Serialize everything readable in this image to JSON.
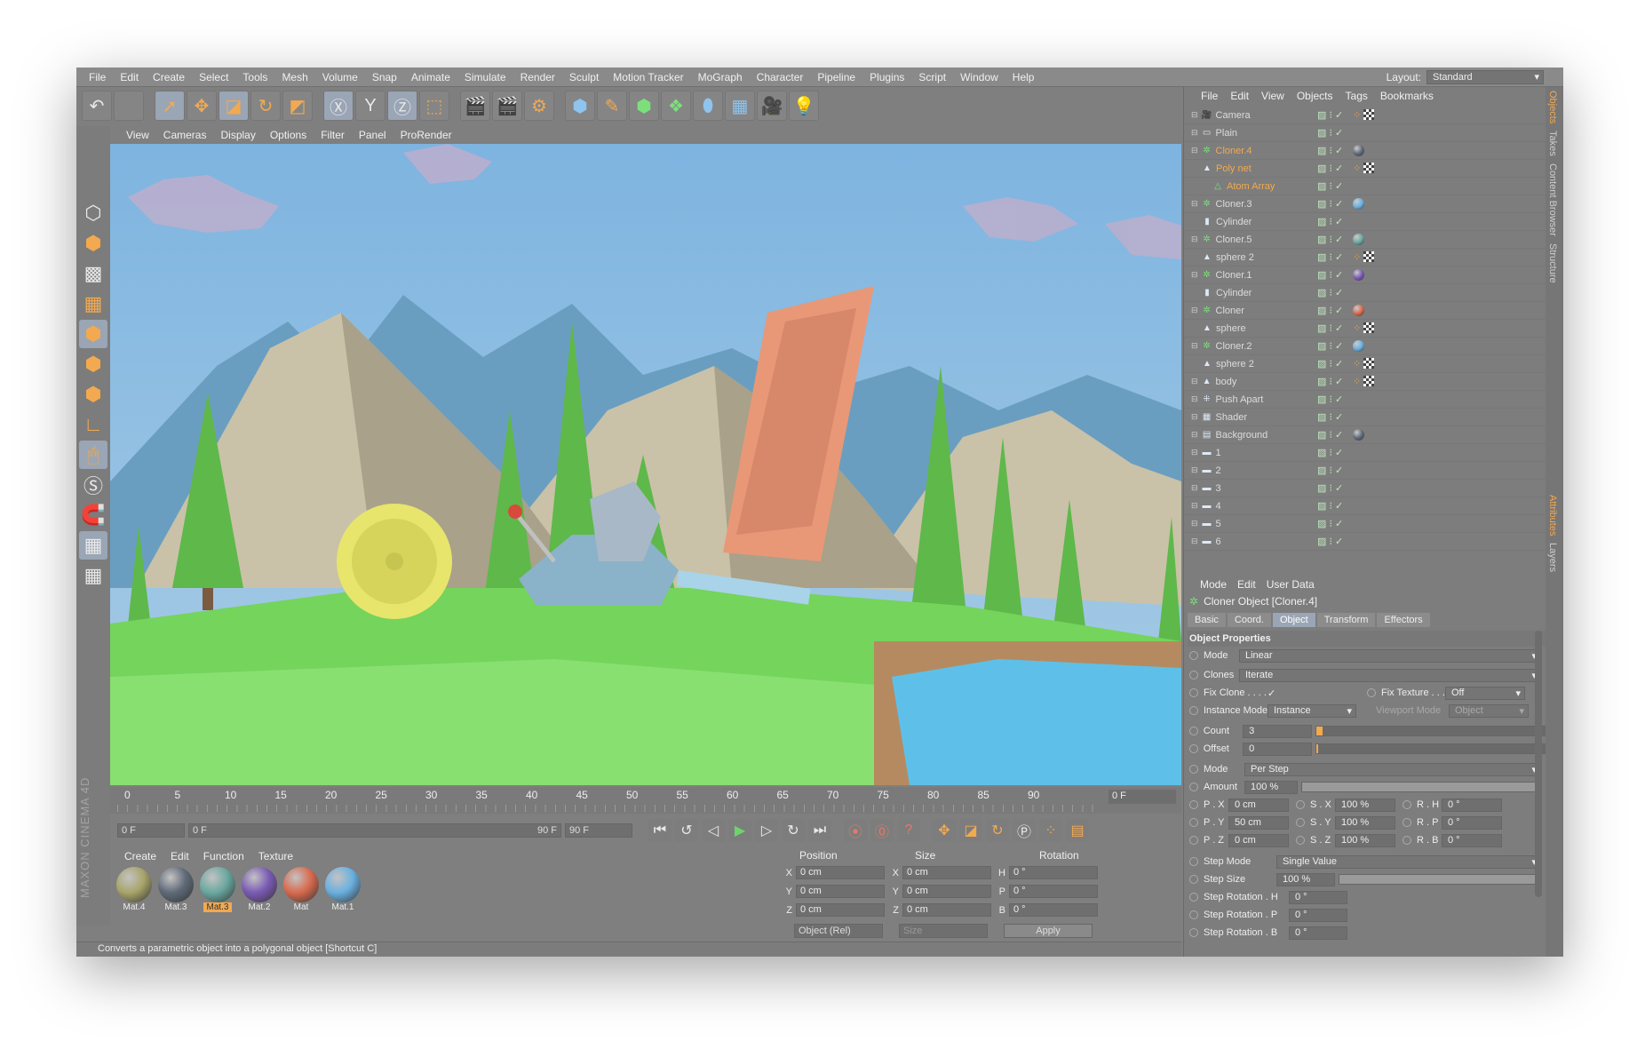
{
  "menu": [
    "File",
    "Edit",
    "Create",
    "Select",
    "Tools",
    "Mesh",
    "Volume",
    "Snap",
    "Animate",
    "Simulate",
    "Render",
    "Sculpt",
    "Motion Tracker",
    "MoGraph",
    "Character",
    "Pipeline",
    "Plugins",
    "Script",
    "Window",
    "Help"
  ],
  "layout": {
    "label": "Layout:",
    "value": "Standard"
  },
  "viewport_menu": [
    "View",
    "Cameras",
    "Display",
    "Options",
    "Filter",
    "Panel",
    "ProRender"
  ],
  "timeline": {
    "ticks": [
      "0",
      "5",
      "10",
      "15",
      "20",
      "25",
      "30",
      "35",
      "40",
      "45",
      "50",
      "55",
      "60",
      "65",
      "70",
      "75",
      "80",
      "85",
      "90"
    ],
    "frame": "0 F"
  },
  "transport": {
    "start": "0 F",
    "range_start": "0 F",
    "range_end": "90 F",
    "end": "90 F"
  },
  "material_menu": [
    "Create",
    "Edit",
    "Function",
    "Texture"
  ],
  "materials": [
    {
      "name": "Mat.4",
      "color": "#a8a46a"
    },
    {
      "name": "Mat.3",
      "color": "#5f6a78"
    },
    {
      "name": "Mat.3",
      "color": "#6aa8a0",
      "selected": true
    },
    {
      "name": "Mat.2",
      "color": "#7a5ab4"
    },
    {
      "name": "Mat",
      "color": "#d86a4e"
    },
    {
      "name": "Mat.1",
      "color": "#6ab0e0"
    }
  ],
  "brand": "MAXON CINEMA 4D",
  "coords": {
    "headers": [
      "Position",
      "Size",
      "Rotation"
    ],
    "rows": [
      {
        "pa": "X",
        "pv": "0 cm",
        "sa": "X",
        "sv": "0 cm",
        "ra": "H",
        "rv": "0 °"
      },
      {
        "pa": "Y",
        "pv": "0 cm",
        "sa": "Y",
        "sv": "0 cm",
        "ra": "P",
        "rv": "0 °"
      },
      {
        "pa": "Z",
        "pv": "0 cm",
        "sa": "Z",
        "sv": "0 cm",
        "ra": "B",
        "rv": "0 °"
      }
    ],
    "mode": "Object (Rel)",
    "size_mode": "Size",
    "apply": "Apply"
  },
  "status": "Converts a parametric object into a polygonal object [Shortcut C]",
  "objects_menu": [
    "File",
    "Edit",
    "View",
    "Objects",
    "Tags",
    "Bookmarks"
  ],
  "objects": [
    {
      "name": "Camera",
      "icon": "camera-icon",
      "indent": 0,
      "tag": "chk"
    },
    {
      "name": "Plain",
      "icon": "plain-effector-icon",
      "indent": 0
    },
    {
      "name": "Cloner.4",
      "icon": "cloner-icon",
      "indent": 0,
      "hl": true,
      "tag": "ball",
      "color": "#5f6a78"
    },
    {
      "name": "Poly net",
      "icon": "polygon-icon",
      "indent": 1,
      "hl": true,
      "tag": "chk"
    },
    {
      "name": "Atom Array",
      "icon": "atom-array-icon",
      "indent": 2,
      "hl": true
    },
    {
      "name": "Cloner.3",
      "icon": "cloner-icon",
      "indent": 0,
      "tag": "ball",
      "color": "#6ab0e0"
    },
    {
      "name": "Cylinder",
      "icon": "cylinder-icon",
      "indent": 1
    },
    {
      "name": "Cloner.5",
      "icon": "cloner-icon",
      "indent": 0,
      "tag": "ball",
      "color": "#6aa8a0"
    },
    {
      "name": "sphere 2",
      "icon": "polygon-icon",
      "indent": 1,
      "tag": "chk"
    },
    {
      "name": "Cloner.1",
      "icon": "cloner-icon",
      "indent": 0,
      "tag": "ball",
      "color": "#7a5ab4"
    },
    {
      "name": "Cylinder",
      "icon": "cylinder-icon",
      "indent": 1
    },
    {
      "name": "Cloner",
      "icon": "cloner-icon",
      "indent": 0,
      "tag": "ball",
      "color": "#d86a4e"
    },
    {
      "name": "sphere",
      "icon": "polygon-icon",
      "indent": 1,
      "tag": "chk"
    },
    {
      "name": "Cloner.2",
      "icon": "cloner-icon",
      "indent": 0,
      "tag": "ball",
      "color": "#6ab0e0"
    },
    {
      "name": "sphere 2",
      "icon": "polygon-icon",
      "indent": 1,
      "tag": "chk"
    },
    {
      "name": "body",
      "icon": "polygon-icon",
      "indent": 0,
      "tag": "chk"
    },
    {
      "name": "Push Apart",
      "icon": "push-apart-icon",
      "indent": 0
    },
    {
      "name": "Shader",
      "icon": "shader-icon",
      "indent": 0
    },
    {
      "name": "Background",
      "icon": "background-icon",
      "indent": 0,
      "tag": "ball",
      "color": "#5f6a78"
    },
    {
      "name": "1",
      "icon": "folder-icon",
      "indent": 0
    },
    {
      "name": "2",
      "icon": "folder-icon",
      "indent": 0
    },
    {
      "name": "3",
      "icon": "folder-icon",
      "indent": 0
    },
    {
      "name": "4",
      "icon": "folder-icon",
      "indent": 0
    },
    {
      "name": "5",
      "icon": "folder-icon",
      "indent": 0
    },
    {
      "name": "6",
      "icon": "folder-icon",
      "indent": 0
    }
  ],
  "right_tabs": [
    "Objects",
    "Takes",
    "Content Browser",
    "Structure"
  ],
  "attr_tabs_side": [
    "Attributes",
    "Layers"
  ],
  "attr_menu": [
    "Mode",
    "Edit",
    "User Data"
  ],
  "attr_title": "Cloner Object [Cloner.4]",
  "attr_tabs": [
    "Basic",
    "Coord.",
    "Object",
    "Transform",
    "Effectors"
  ],
  "attr": {
    "section": "Object Properties",
    "mode_label": "Mode",
    "mode": "Linear",
    "clones_label": "Clones",
    "clones": "Iterate",
    "fixclone_label": "Fix Clone . . . .",
    "fixclone": "✓",
    "fixtexture_label": "Fix Texture . . .",
    "fixtexture": "Off",
    "instance_label": "Instance Mode",
    "instance": "Instance",
    "viewport_label": "Viewport Mode",
    "viewport": "Object",
    "count_label": "Count",
    "count": "3",
    "offset_label": "Offset",
    "offset": "0",
    "mode2_label": "Mode",
    "mode2": "Per Step",
    "amount_label": "Amount",
    "amount": "100 %",
    "px_label": "P . X",
    "px": "0 cm",
    "sx_label": "S . X",
    "sx": "100 %",
    "rh_label": "R . H",
    "rh": "0 °",
    "py_label": "P . Y",
    "py": "50 cm",
    "sy_label": "S . Y",
    "sy": "100 %",
    "rp_label": "R . P",
    "rp": "0 °",
    "pz_label": "P . Z",
    "pz": "0 cm",
    "sz_label": "S . Z",
    "sz": "100 %",
    "rb_label": "R . B",
    "rb": "0 °",
    "stepmode_label": "Step Mode",
    "stepmode": "Single Value",
    "stepsize_label": "Step Size",
    "stepsize": "100 %",
    "steph_label": "Step Rotation . H",
    "steph": "0 °",
    "stepp_label": "Step Rotation . P",
    "stepp": "0 °",
    "stepb_label": "Step Rotation . B",
    "stepb": "0 °"
  },
  "colors": {
    "accent": "#f2a950",
    "highlight": "#9aa5b5"
  }
}
